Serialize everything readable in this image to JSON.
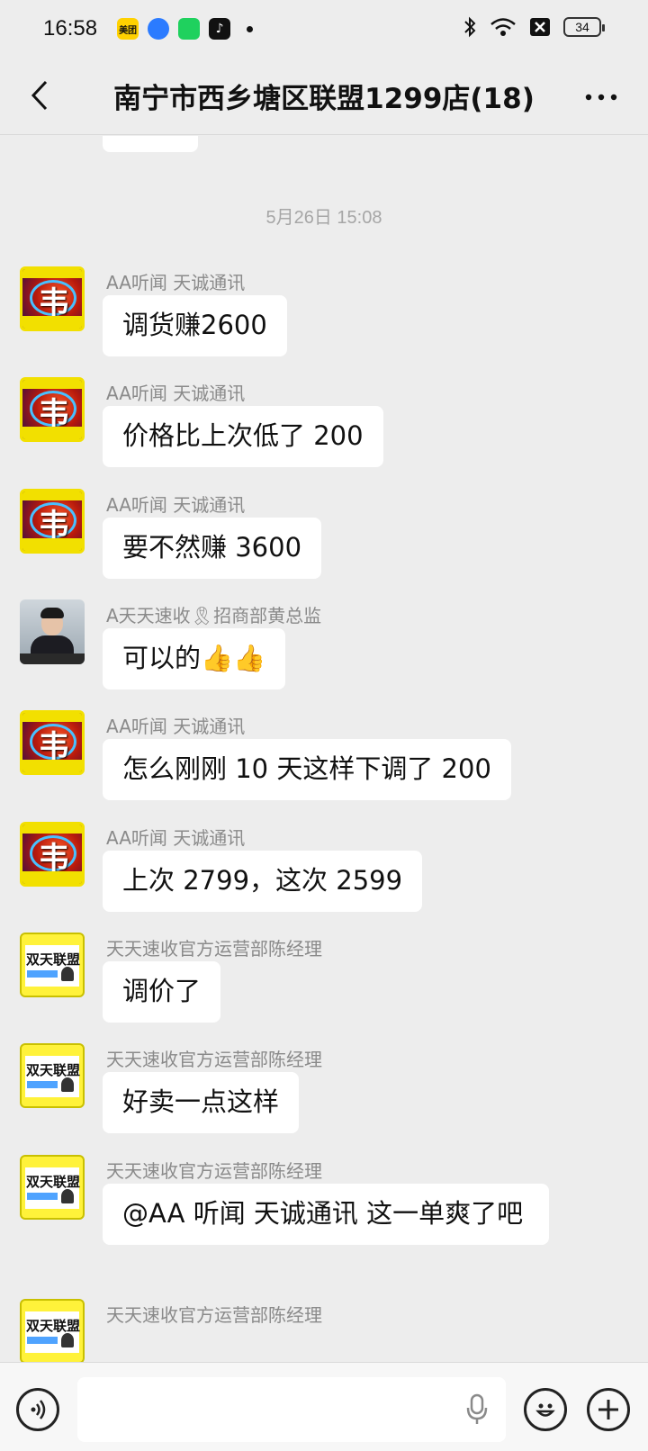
{
  "status_bar": {
    "time": "16:58",
    "apps": [
      {
        "icon": "meituan-app-icon",
        "label": "美团",
        "color": "#ffd100"
      },
      {
        "icon": "browser-app-icon",
        "label": "",
        "color": "#2b7bff"
      },
      {
        "icon": "wechat-app-icon",
        "label": "",
        "color": "#1fd15e"
      },
      {
        "icon": "tiktok-app-icon",
        "label": "",
        "color": "#111111"
      }
    ],
    "battery": "34"
  },
  "header": {
    "title": "南宁市西乡塘区联盟1299店(18)"
  },
  "chat": {
    "timestamp": "5月26日 15:08",
    "messages": [
      {
        "sender": "AA听闻 天诚通讯",
        "text": "调货赚2600",
        "avatar": "red"
      },
      {
        "sender": "AA听闻 天诚通讯",
        "text": "价格比上次低了 200",
        "avatar": "red"
      },
      {
        "sender": "AA听闻 天诚通讯",
        "text": "要不然赚 3600",
        "avatar": "red"
      },
      {
        "sender": "A天天速收🎗招商部黄总监",
        "text": "可以的👍👍",
        "avatar": "person"
      },
      {
        "sender": "AA听闻 天诚通讯",
        "text": "怎么刚刚 10 天这样下调了 200",
        "avatar": "red"
      },
      {
        "sender": "AA听闻 天诚通讯",
        "text": "上次 2799，这次 2599",
        "avatar": "red"
      },
      {
        "sender": "天天速收官方运营部陈经理",
        "text": "调价了",
        "avatar": "yellow"
      },
      {
        "sender": "天天速收官方运营部陈经理",
        "text": "好卖一点这样",
        "avatar": "yellow"
      },
      {
        "sender": "天天速收官方运营部陈经理",
        "text": "@AA 听闻 天诚通讯  这一单爽了吧",
        "avatar": "yellow"
      },
      {
        "sender": "天天速收官方运营部陈经理",
        "text": "",
        "avatar": "yellow"
      }
    ],
    "avatar_text": {
      "red": "韦",
      "yellow": "双天联盟"
    }
  },
  "input_bar": {
    "placeholder": ""
  }
}
